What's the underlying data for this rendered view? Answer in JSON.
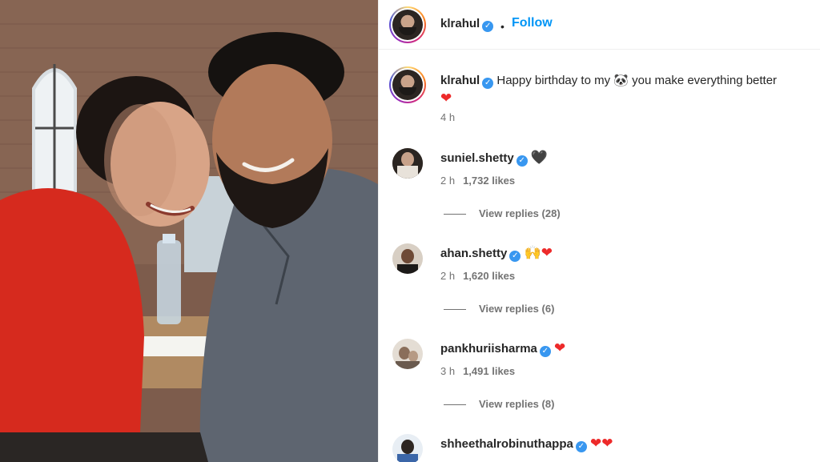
{
  "post": {
    "author": "klrahul",
    "follow_label": "Follow",
    "dot": "•",
    "verified_glyph": "✓",
    "caption_text": "Happy birthday to my",
    "caption_emoji": "🐼",
    "caption_text_2": "you make everything better",
    "caption_heart": "❤",
    "caption_time": "4 h"
  },
  "comments": [
    {
      "user": "suniel.shetty",
      "text": "🖤",
      "time": "2 h",
      "likes": "1,732 likes",
      "replies": "View replies (28)",
      "avatar_color": "#8a7a6a"
    },
    {
      "user": "ahan.shetty",
      "text": "🙌❤",
      "time": "2 h",
      "likes": "1,620 likes",
      "replies": "View replies (6)",
      "avatar_color": "#5a4638"
    },
    {
      "user": "pankhuriisharma",
      "text": "❤",
      "time": "3 h",
      "likes": "1,491 likes",
      "replies": "View replies (8)",
      "avatar_color": "#b8a79a"
    },
    {
      "user": "shheethalrobinuthappa",
      "text": "❤❤",
      "time": "",
      "likes": "",
      "replies": "",
      "avatar_color": "#4a6fa0"
    }
  ],
  "colors": {
    "link": "#0095f6",
    "verified": "#3897f0",
    "heart": "#ed2a2a",
    "muted": "#737373"
  }
}
